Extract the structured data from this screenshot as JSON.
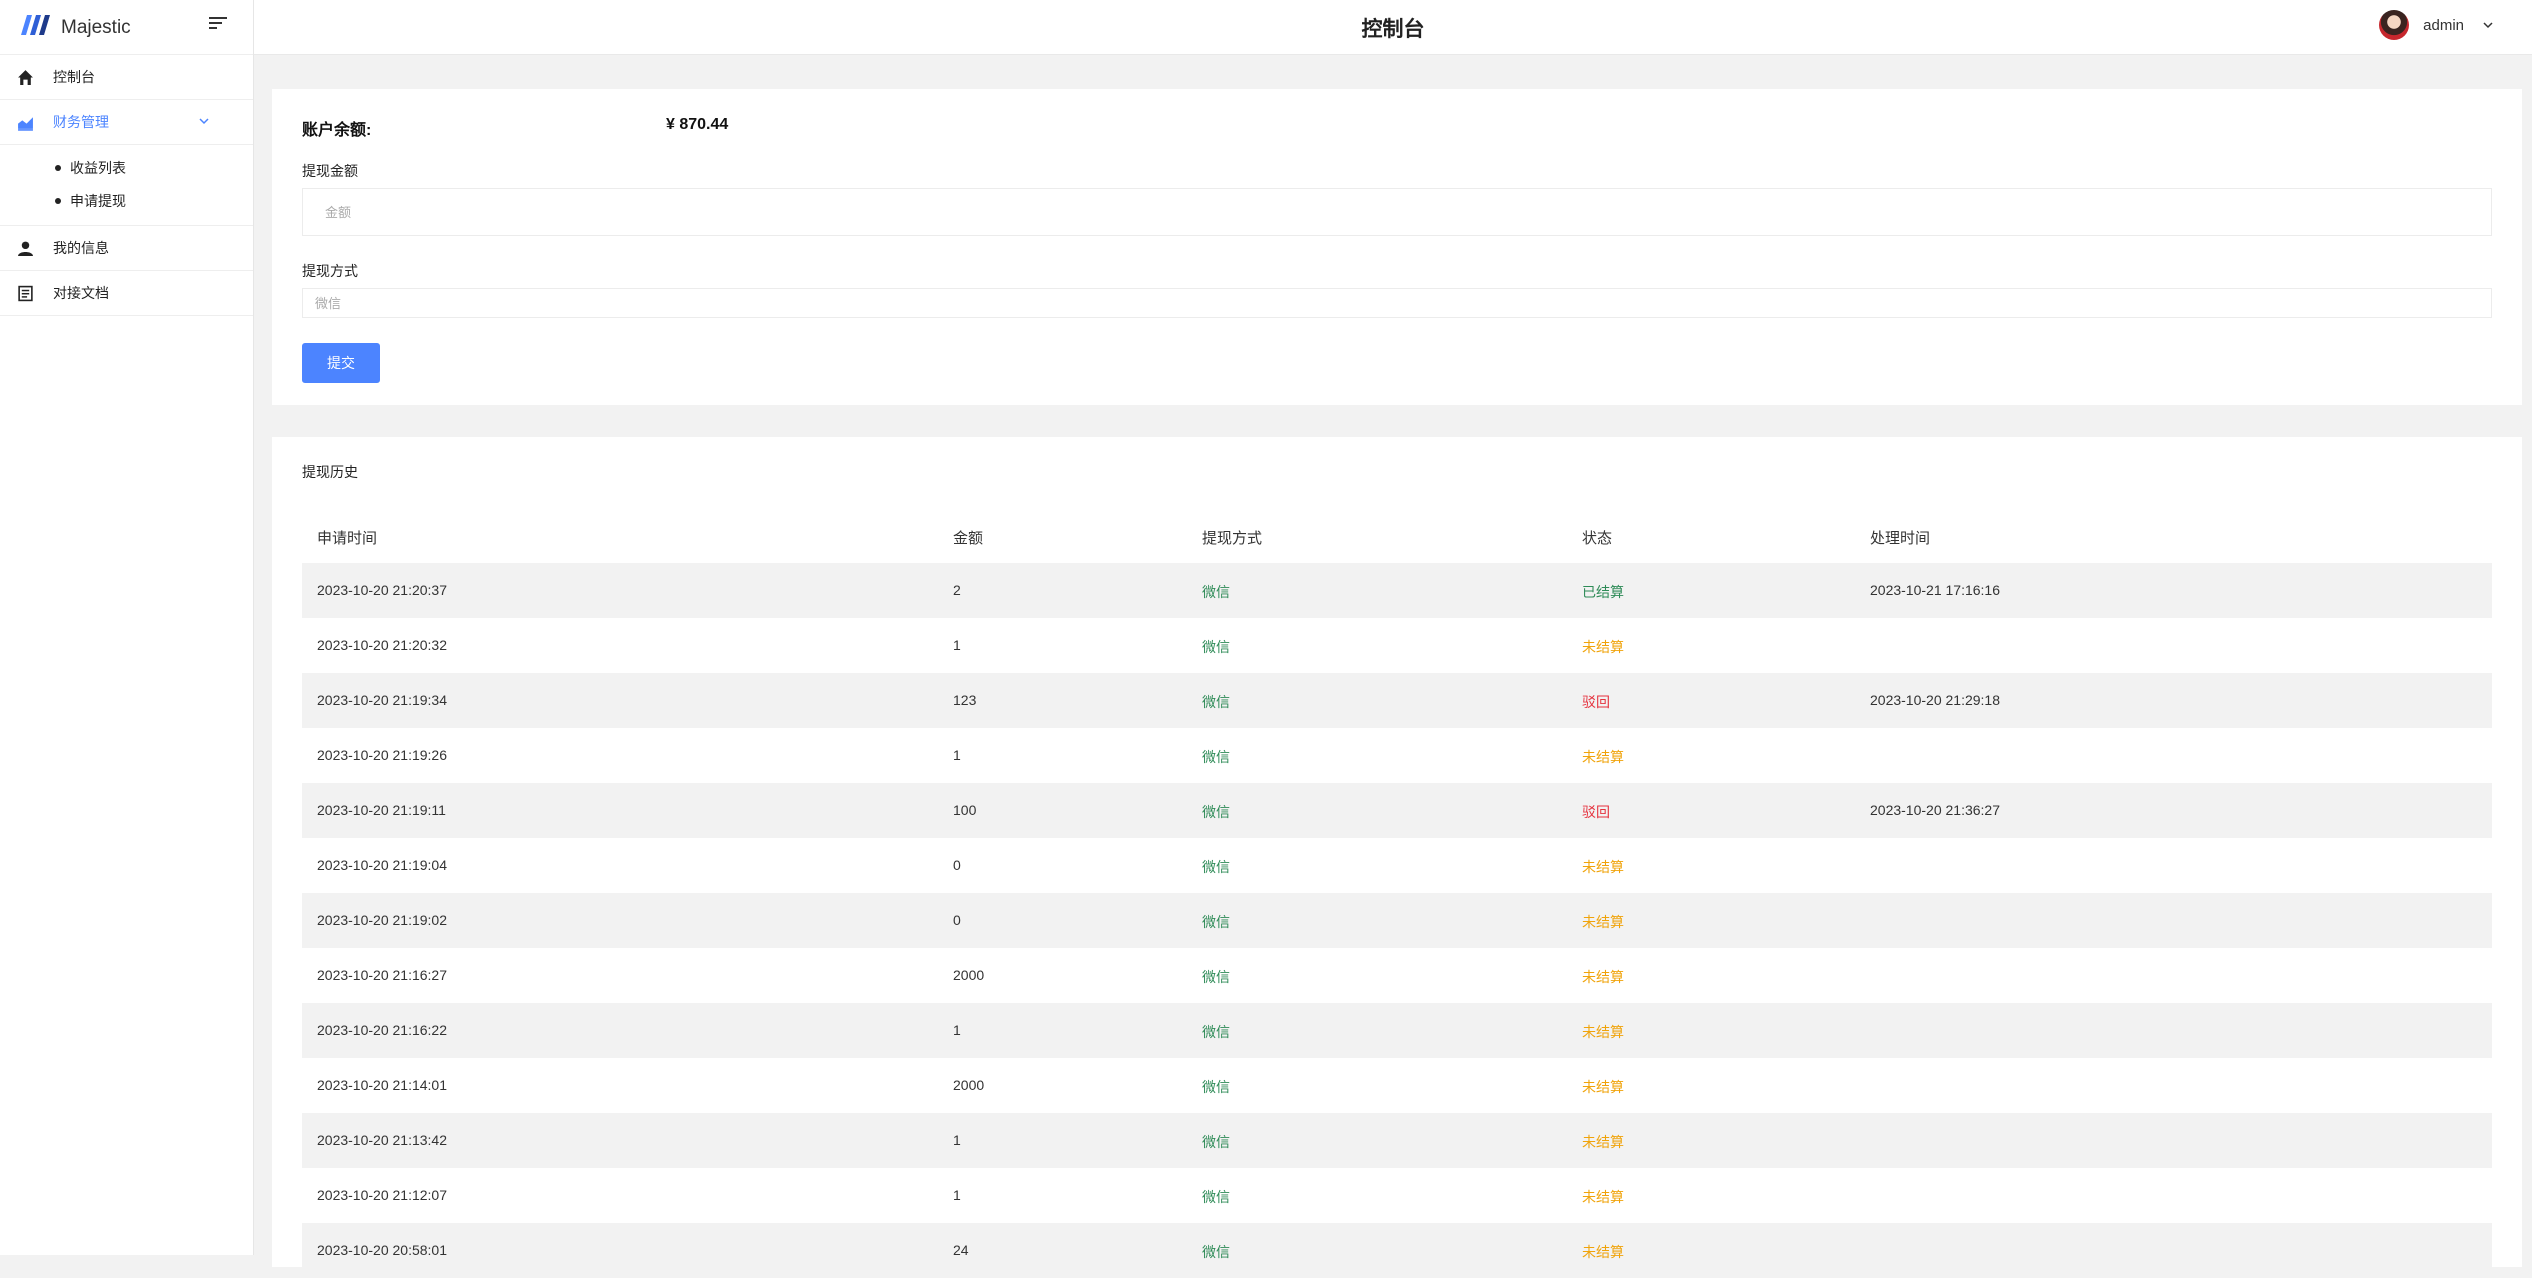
{
  "brand": {
    "name": "Majestic"
  },
  "header": {
    "title": "控制台",
    "user": "admin"
  },
  "sidebar": {
    "items": [
      {
        "label": "控制台",
        "icon": "home-icon"
      },
      {
        "label": "财务管理",
        "icon": "chart-icon",
        "expanded": true,
        "children": [
          {
            "label": "收益列表"
          },
          {
            "label": "申请提现"
          }
        ]
      },
      {
        "label": "我的信息",
        "icon": "user-icon"
      },
      {
        "label": "对接文档",
        "icon": "document-icon"
      }
    ]
  },
  "form": {
    "balance_label": "账户余额:",
    "balance_value": "¥ 870.44",
    "amount_label": "提现金额",
    "amount_placeholder": "金额",
    "method_label": "提现方式",
    "method_value": "微信",
    "submit_label": "提交"
  },
  "history": {
    "title": "提现历史",
    "columns": [
      "申请时间",
      "金额",
      "提现方式",
      "状态",
      "处理时间"
    ],
    "rows": [
      {
        "time": "2023-10-20 21:20:37",
        "amount": "2",
        "method": "微信",
        "status": "已结算",
        "status_type": "done",
        "processed": "2023-10-21 17:16:16"
      },
      {
        "time": "2023-10-20 21:20:32",
        "amount": "1",
        "method": "微信",
        "status": "未结算",
        "status_type": "pending",
        "processed": ""
      },
      {
        "time": "2023-10-20 21:19:34",
        "amount": "123",
        "method": "微信",
        "status": "驳回",
        "status_type": "reject",
        "processed": "2023-10-20 21:29:18"
      },
      {
        "time": "2023-10-20 21:19:26",
        "amount": "1",
        "method": "微信",
        "status": "未结算",
        "status_type": "pending",
        "processed": ""
      },
      {
        "time": "2023-10-20 21:19:11",
        "amount": "100",
        "method": "微信",
        "status": "驳回",
        "status_type": "reject",
        "processed": "2023-10-20 21:36:27"
      },
      {
        "time": "2023-10-20 21:19:04",
        "amount": "0",
        "method": "微信",
        "status": "未结算",
        "status_type": "pending",
        "processed": ""
      },
      {
        "time": "2023-10-20 21:19:02",
        "amount": "0",
        "method": "微信",
        "status": "未结算",
        "status_type": "pending",
        "processed": ""
      },
      {
        "time": "2023-10-20 21:16:27",
        "amount": "2000",
        "method": "微信",
        "status": "未结算",
        "status_type": "pending",
        "processed": ""
      },
      {
        "time": "2023-10-20 21:16:22",
        "amount": "1",
        "method": "微信",
        "status": "未结算",
        "status_type": "pending",
        "processed": ""
      },
      {
        "time": "2023-10-20 21:14:01",
        "amount": "2000",
        "method": "微信",
        "status": "未结算",
        "status_type": "pending",
        "processed": ""
      },
      {
        "time": "2023-10-20 21:13:42",
        "amount": "1",
        "method": "微信",
        "status": "未结算",
        "status_type": "pending",
        "processed": ""
      },
      {
        "time": "2023-10-20 21:12:07",
        "amount": "1",
        "method": "微信",
        "status": "未结算",
        "status_type": "pending",
        "processed": ""
      },
      {
        "time": "2023-10-20 20:58:01",
        "amount": "24",
        "method": "微信",
        "status": "未结算",
        "status_type": "pending",
        "processed": ""
      }
    ]
  },
  "colors": {
    "accent": "#4c84ff",
    "done": "#2e8b57",
    "pending": "#f0a30a",
    "reject": "#e5323e"
  }
}
